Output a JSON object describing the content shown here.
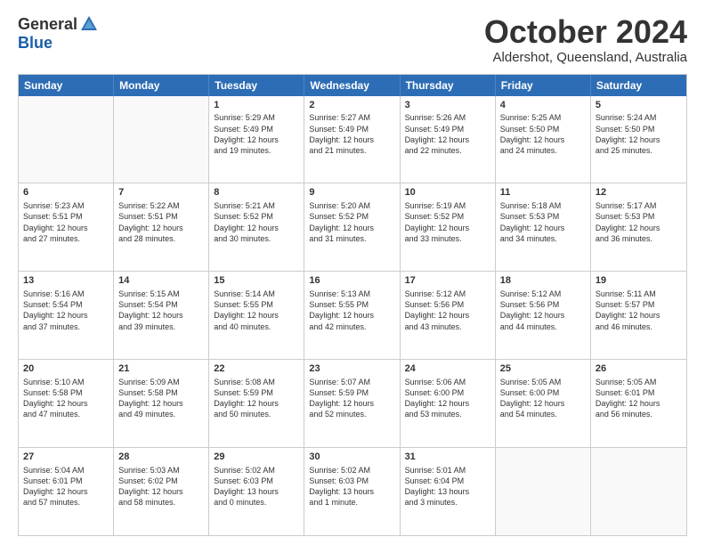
{
  "logo": {
    "general": "General",
    "blue": "Blue"
  },
  "title": "October 2024",
  "subtitle": "Aldershot, Queensland, Australia",
  "header_days": [
    "Sunday",
    "Monday",
    "Tuesday",
    "Wednesday",
    "Thursday",
    "Friday",
    "Saturday"
  ],
  "weeks": [
    [
      {
        "day": "",
        "info": ""
      },
      {
        "day": "",
        "info": ""
      },
      {
        "day": "1",
        "info": "Sunrise: 5:29 AM\nSunset: 5:49 PM\nDaylight: 12 hours\nand 19 minutes."
      },
      {
        "day": "2",
        "info": "Sunrise: 5:27 AM\nSunset: 5:49 PM\nDaylight: 12 hours\nand 21 minutes."
      },
      {
        "day": "3",
        "info": "Sunrise: 5:26 AM\nSunset: 5:49 PM\nDaylight: 12 hours\nand 22 minutes."
      },
      {
        "day": "4",
        "info": "Sunrise: 5:25 AM\nSunset: 5:50 PM\nDaylight: 12 hours\nand 24 minutes."
      },
      {
        "day": "5",
        "info": "Sunrise: 5:24 AM\nSunset: 5:50 PM\nDaylight: 12 hours\nand 25 minutes."
      }
    ],
    [
      {
        "day": "6",
        "info": "Sunrise: 5:23 AM\nSunset: 5:51 PM\nDaylight: 12 hours\nand 27 minutes."
      },
      {
        "day": "7",
        "info": "Sunrise: 5:22 AM\nSunset: 5:51 PM\nDaylight: 12 hours\nand 28 minutes."
      },
      {
        "day": "8",
        "info": "Sunrise: 5:21 AM\nSunset: 5:52 PM\nDaylight: 12 hours\nand 30 minutes."
      },
      {
        "day": "9",
        "info": "Sunrise: 5:20 AM\nSunset: 5:52 PM\nDaylight: 12 hours\nand 31 minutes."
      },
      {
        "day": "10",
        "info": "Sunrise: 5:19 AM\nSunset: 5:52 PM\nDaylight: 12 hours\nand 33 minutes."
      },
      {
        "day": "11",
        "info": "Sunrise: 5:18 AM\nSunset: 5:53 PM\nDaylight: 12 hours\nand 34 minutes."
      },
      {
        "day": "12",
        "info": "Sunrise: 5:17 AM\nSunset: 5:53 PM\nDaylight: 12 hours\nand 36 minutes."
      }
    ],
    [
      {
        "day": "13",
        "info": "Sunrise: 5:16 AM\nSunset: 5:54 PM\nDaylight: 12 hours\nand 37 minutes."
      },
      {
        "day": "14",
        "info": "Sunrise: 5:15 AM\nSunset: 5:54 PM\nDaylight: 12 hours\nand 39 minutes."
      },
      {
        "day": "15",
        "info": "Sunrise: 5:14 AM\nSunset: 5:55 PM\nDaylight: 12 hours\nand 40 minutes."
      },
      {
        "day": "16",
        "info": "Sunrise: 5:13 AM\nSunset: 5:55 PM\nDaylight: 12 hours\nand 42 minutes."
      },
      {
        "day": "17",
        "info": "Sunrise: 5:12 AM\nSunset: 5:56 PM\nDaylight: 12 hours\nand 43 minutes."
      },
      {
        "day": "18",
        "info": "Sunrise: 5:12 AM\nSunset: 5:56 PM\nDaylight: 12 hours\nand 44 minutes."
      },
      {
        "day": "19",
        "info": "Sunrise: 5:11 AM\nSunset: 5:57 PM\nDaylight: 12 hours\nand 46 minutes."
      }
    ],
    [
      {
        "day": "20",
        "info": "Sunrise: 5:10 AM\nSunset: 5:58 PM\nDaylight: 12 hours\nand 47 minutes."
      },
      {
        "day": "21",
        "info": "Sunrise: 5:09 AM\nSunset: 5:58 PM\nDaylight: 12 hours\nand 49 minutes."
      },
      {
        "day": "22",
        "info": "Sunrise: 5:08 AM\nSunset: 5:59 PM\nDaylight: 12 hours\nand 50 minutes."
      },
      {
        "day": "23",
        "info": "Sunrise: 5:07 AM\nSunset: 5:59 PM\nDaylight: 12 hours\nand 52 minutes."
      },
      {
        "day": "24",
        "info": "Sunrise: 5:06 AM\nSunset: 6:00 PM\nDaylight: 12 hours\nand 53 minutes."
      },
      {
        "day": "25",
        "info": "Sunrise: 5:05 AM\nSunset: 6:00 PM\nDaylight: 12 hours\nand 54 minutes."
      },
      {
        "day": "26",
        "info": "Sunrise: 5:05 AM\nSunset: 6:01 PM\nDaylight: 12 hours\nand 56 minutes."
      }
    ],
    [
      {
        "day": "27",
        "info": "Sunrise: 5:04 AM\nSunset: 6:01 PM\nDaylight: 12 hours\nand 57 minutes."
      },
      {
        "day": "28",
        "info": "Sunrise: 5:03 AM\nSunset: 6:02 PM\nDaylight: 12 hours\nand 58 minutes."
      },
      {
        "day": "29",
        "info": "Sunrise: 5:02 AM\nSunset: 6:03 PM\nDaylight: 13 hours\nand 0 minutes."
      },
      {
        "day": "30",
        "info": "Sunrise: 5:02 AM\nSunset: 6:03 PM\nDaylight: 13 hours\nand 1 minute."
      },
      {
        "day": "31",
        "info": "Sunrise: 5:01 AM\nSunset: 6:04 PM\nDaylight: 13 hours\nand 3 minutes."
      },
      {
        "day": "",
        "info": ""
      },
      {
        "day": "",
        "info": ""
      }
    ]
  ]
}
